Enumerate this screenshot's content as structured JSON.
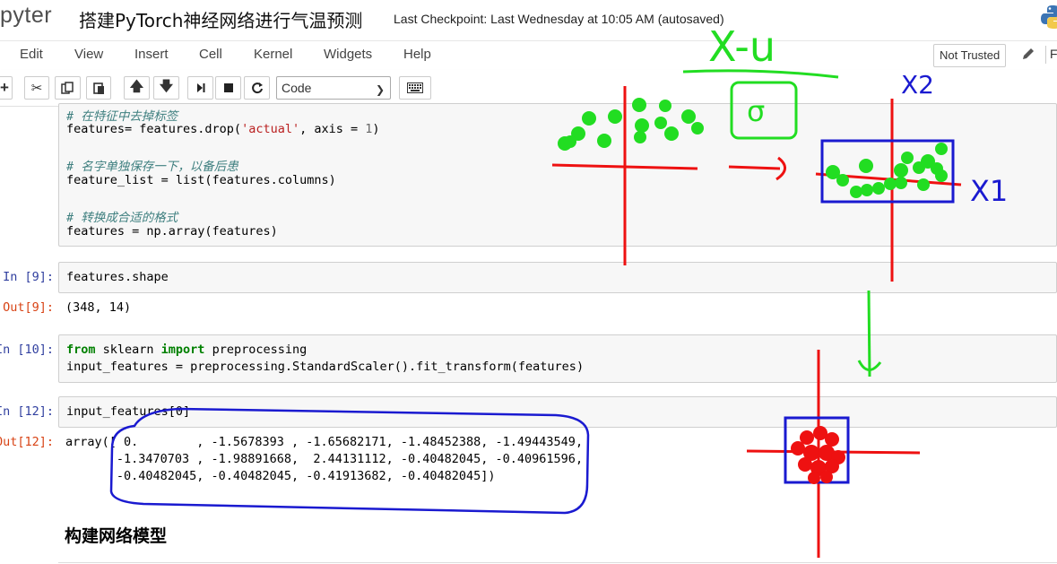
{
  "header": {
    "logo_text": "pyter",
    "notebook_title": "搭建PyTorch神经网络进行气温预测",
    "checkpoint": "Last Checkpoint: Last Wednesday at 10:05 AM (autosaved)"
  },
  "menubar": {
    "items": [
      "Edit",
      "View",
      "Insert",
      "Cell",
      "Kernel",
      "Widgets",
      "Help"
    ],
    "trust_label": "Not Trusted",
    "trailing": "F"
  },
  "toolbar": {
    "cell_type": "Code",
    "icons": [
      "insert-cell-below-icon",
      "cut-icon",
      "copy-icon",
      "paste-icon",
      "move-up-icon",
      "move-down-icon",
      "run-icon",
      "interrupt-icon",
      "restart-icon",
      "command-palette-icon"
    ]
  },
  "cells": {
    "c1": {
      "comment1": "# 在特征中去掉标签",
      "line1_a": "features= features.drop(",
      "line1_str": "'actual'",
      "line1_b": ", axis = ",
      "line1_num": "1",
      "line1_c": ")",
      "comment2": "# 名字单独保存一下，以备后患",
      "line2": "feature_list = list(features.columns)",
      "comment3": "# 转换成合适的格式",
      "line3": "features = np.array(features)"
    },
    "c2": {
      "prompt": "In [9]:",
      "code": "features.shape",
      "out_prompt": "Out[9]:",
      "output": "(348, 14)"
    },
    "c3": {
      "prompt": "In [10]:",
      "kw_from": "from",
      "mod": " sklearn ",
      "kw_import": "import",
      "name": " preprocessing",
      "line2": "input_features = preprocessing.StandardScaler().fit_transform(features)"
    },
    "c4": {
      "prompt": "In [12]:",
      "code": "input_features[0]",
      "out_prompt": "Out[12]:",
      "output_lines": [
        "array([ 0.        , -1.5678393 , -1.65682171, -1.48452388, -1.49443549,",
        "       -1.3470703 , -1.98891668,  2.44131112, -0.40482045, -0.40961596,",
        "       -0.40482045, -0.40482045, -0.41913682, -0.40482045])"
      ]
    }
  },
  "markdown": {
    "heading": "构建网络模型"
  },
  "annotations": {
    "formula_numerator": "X-u",
    "formula_denominator": "σ",
    "axis_label_top": "X2",
    "axis_label_right": "X1",
    "colors": {
      "green": "#22dd22",
      "red": "#ee1111",
      "blue": "#1a1ad0",
      "cell_prompt_in": "#303f9f",
      "cell_prompt_out": "#d84315"
    }
  }
}
